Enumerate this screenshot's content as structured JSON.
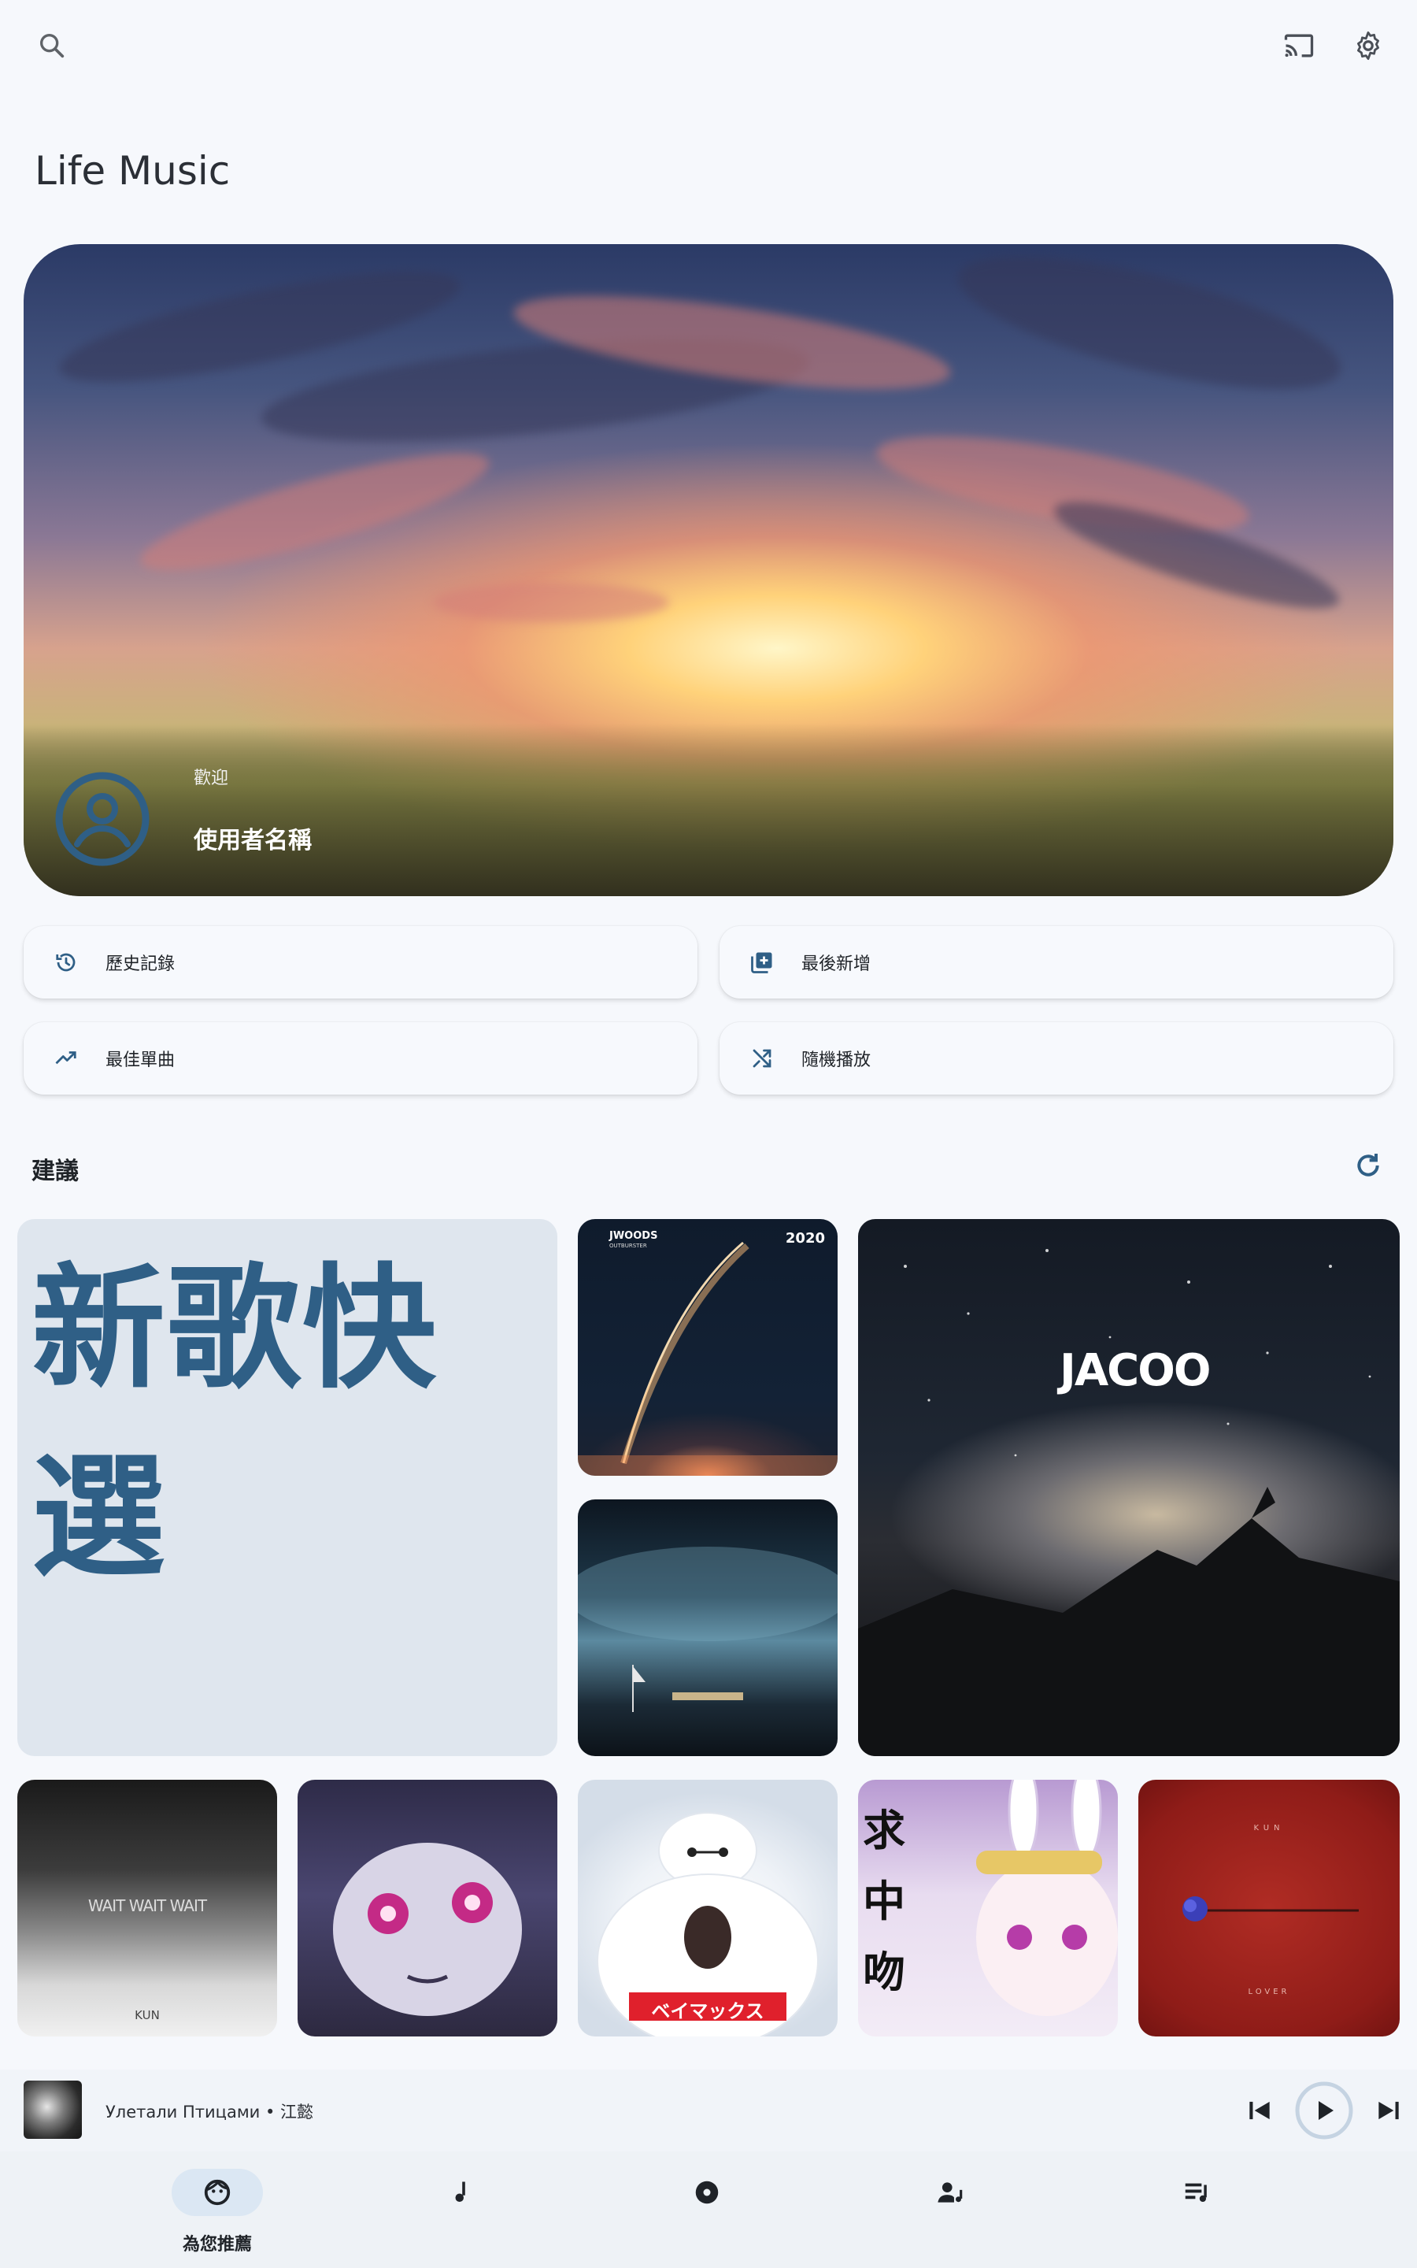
{
  "app_title": "Life Music",
  "hero": {
    "welcome": "歡迎",
    "username": "使用者名稱"
  },
  "quick_actions": [
    {
      "label": "歷史記錄",
      "icon": "history-icon"
    },
    {
      "label": "最後新增",
      "icon": "library-add-icon"
    },
    {
      "label": "最佳單曲",
      "icon": "trending-up-icon"
    },
    {
      "label": "隨機播放",
      "icon": "shuffle-icon"
    }
  ],
  "suggestions": {
    "title": "建議",
    "new_songs_tile": "新歌快選",
    "tiles": [
      {
        "name": "rocket-cover",
        "text_left": "JWOODS",
        "text_sub": "OUTBURSTER",
        "text_right": "2020"
      },
      {
        "name": "ocean-cover"
      },
      {
        "name": "jacoo-cover",
        "text": "JACOO"
      },
      {
        "name": "wait-cover",
        "text": "WAIT WAIT WAIT",
        "text2": "KUN"
      },
      {
        "name": "anime-cover"
      },
      {
        "name": "baymax-cover",
        "text": "ベイマックス"
      },
      {
        "name": "bunny-cover",
        "text": "求 中 吻"
      },
      {
        "name": "red-cover",
        "text": "KUN",
        "text2": "LOVER"
      }
    ]
  },
  "now_playing": {
    "song": "Улетали Птицами • 江懿"
  },
  "bottom_nav": [
    {
      "label": "為您推薦",
      "icon": "face-icon",
      "active": true
    },
    {
      "label": "",
      "icon": "music-note-icon",
      "active": false
    },
    {
      "label": "",
      "icon": "album-icon",
      "active": false
    },
    {
      "label": "",
      "icon": "artist-icon",
      "active": false
    },
    {
      "label": "",
      "icon": "playlist-icon",
      "active": false
    }
  ],
  "colors": {
    "accent": "#2f5f86",
    "background": "#f6f8fc",
    "nav_active_pill": "#dbe7f3"
  }
}
